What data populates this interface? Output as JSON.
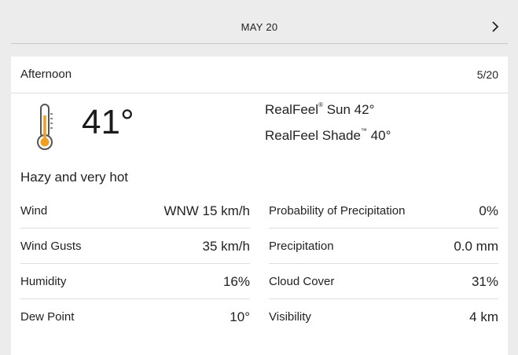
{
  "nav": {
    "date": "MAY 20",
    "next_icon": "chevron-right-icon"
  },
  "card": {
    "period": "Afternoon",
    "date": "5/20",
    "temperature": "41°",
    "realfeel_label": "RealFeel",
    "realfeel_sun": "Sun 42°",
    "realfeel_shade_label": "RealFeel Shade",
    "realfeel_shade": "40°",
    "trademark": "®",
    "tm": "™",
    "phrase": "Hazy and very hot",
    "icon": "thermometer-icon",
    "icon_color": "#f0a020"
  },
  "details_left": [
    {
      "label": "Wind",
      "value": "WNW 15 km/h"
    },
    {
      "label": "Wind Gusts",
      "value": "35 km/h"
    },
    {
      "label": "Humidity",
      "value": "16%"
    },
    {
      "label": "Dew Point",
      "value": "10°"
    }
  ],
  "details_right": [
    {
      "label": "Probability of Precipitation",
      "value": "0%"
    },
    {
      "label": "Precipitation",
      "value": "0.0 mm"
    },
    {
      "label": "Cloud Cover",
      "value": "31%"
    },
    {
      "label": "Visibility",
      "value": "4 km"
    }
  ]
}
